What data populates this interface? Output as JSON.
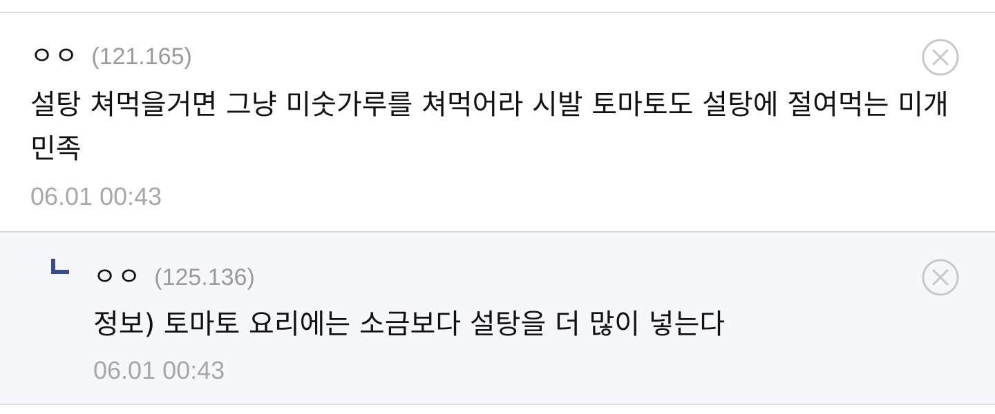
{
  "comment": {
    "nickname": "ㅇㅇ",
    "ip": "(121.165)",
    "text": "설탕 쳐먹을거면 그냥 미숫가루를 쳐먹어라 시발 토마토도 설탕에 절여먹는 미개민족",
    "timestamp": "06.01 00:43"
  },
  "reply": {
    "nickname": "ㅇㅇ",
    "ip": "(125.136)",
    "text": "정보) 토마토 요리에는 소금보다 설탕을 더 많이 넣는다",
    "timestamp": "06.01 00:43"
  },
  "icons": {
    "delete": "close-circle-icon",
    "reply_marker": "reply-arrow-icon"
  },
  "colors": {
    "reply_background": "#f6f7fb",
    "reply_marker": "#3b4a8c",
    "meta_text": "#9a9a9a"
  }
}
